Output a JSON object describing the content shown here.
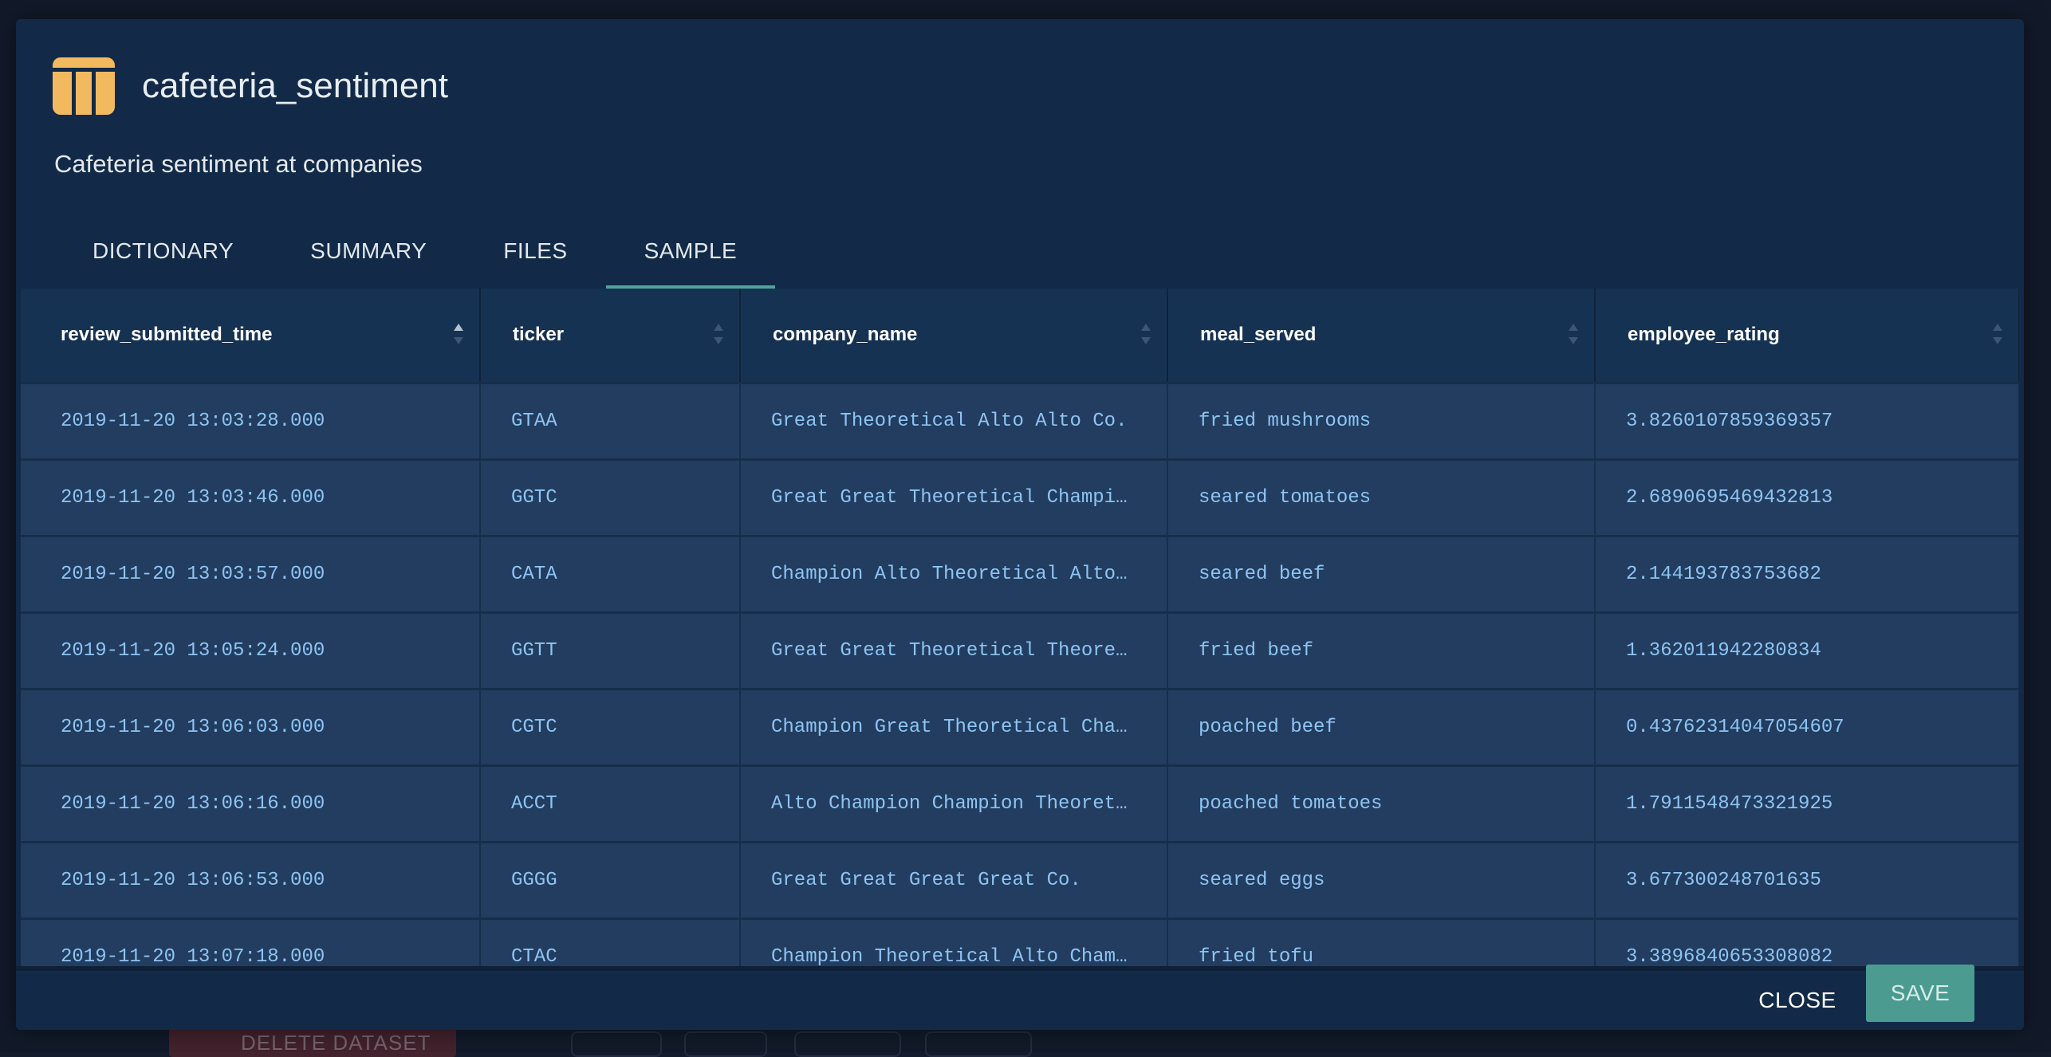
{
  "dataset": {
    "title": "cafeteria_sentiment",
    "description": "Cafeteria sentiment at companies",
    "icon": "table-icon",
    "icon_color": "#f3b95f"
  },
  "tabs": [
    {
      "label": "DICTIONARY",
      "active": false
    },
    {
      "label": "SUMMARY",
      "active": false
    },
    {
      "label": "FILES",
      "active": false
    },
    {
      "label": "SAMPLE",
      "active": true
    }
  ],
  "table": {
    "columns": [
      "review_submitted_time",
      "ticker",
      "company_name",
      "meal_served",
      "employee_rating"
    ],
    "sorted_column": "review_submitted_time",
    "sort_direction": "ascending",
    "rows": [
      [
        "2019-11-20 13:03:28.000",
        "GTAA",
        "Great Theoretical Alto Alto Co.",
        "fried mushrooms",
        "3.8260107859369357"
      ],
      [
        "2019-11-20 13:03:46.000",
        "GGTC",
        "Great Great Theoretical Champi…",
        "seared tomatoes",
        "2.6890695469432813"
      ],
      [
        "2019-11-20 13:03:57.000",
        "CATA",
        "Champion Alto Theoretical Alto…",
        "seared beef",
        "2.144193783753682"
      ],
      [
        "2019-11-20 13:05:24.000",
        "GGTT",
        "Great Great Theoretical Theore…",
        "fried beef",
        "1.362011942280834"
      ],
      [
        "2019-11-20 13:06:03.000",
        "CGTC",
        "Champion Great Theoretical Cha…",
        "poached beef",
        "0.43762314047054607"
      ],
      [
        "2019-11-20 13:06:16.000",
        "ACCT",
        "Alto Champion Champion Theoret…",
        "poached tomatoes",
        "1.7911548473321925"
      ],
      [
        "2019-11-20 13:06:53.000",
        "GGGG",
        "Great Great Great Great Co.",
        "seared eggs",
        "3.677300248701635"
      ],
      [
        "2019-11-20 13:07:18.000",
        "CTAC",
        "Champion Theoretical Alto Cham…",
        "fried tofu",
        "3.3896840653308082"
      ]
    ]
  },
  "footer": {
    "close_label": "CLOSE",
    "save_label": "SAVE"
  },
  "background": {
    "delete_label": "DELETE DATASET"
  },
  "colors": {
    "modal_bg": "#122a47",
    "accent": "#4fa39a",
    "cell_text": "#8ec4f2",
    "save_button": "#4b9b91"
  }
}
